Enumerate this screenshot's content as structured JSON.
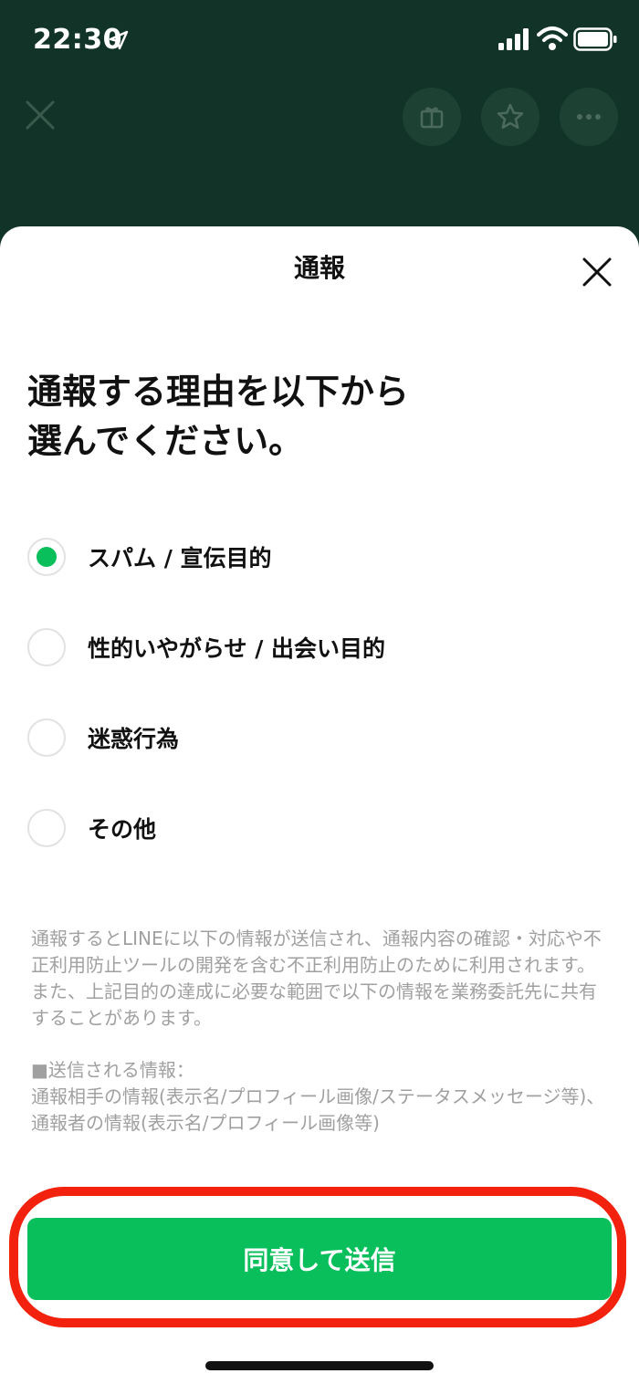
{
  "status_bar": {
    "time": "22:30",
    "icons": [
      "location-arrow-icon",
      "signal-icon",
      "wifi-icon",
      "battery-icon"
    ]
  },
  "background_header": {
    "icons": [
      "close-icon",
      "present-icon",
      "star-icon",
      "more-icon"
    ]
  },
  "sheet": {
    "title": "通報",
    "close_icon": "close-icon",
    "prompt_line1": "通報する理由を以下から",
    "prompt_line2": "選んでください。",
    "options": [
      {
        "label": "スパム / 宣伝目的",
        "selected": true
      },
      {
        "label": "性的いやがらせ / 出会い目的",
        "selected": false
      },
      {
        "label": "迷惑行為",
        "selected": false
      },
      {
        "label": "その他",
        "selected": false
      }
    ],
    "notice": {
      "para1": "通報するとLINEに以下の情報が送信され、通報内容の確認・対応や不正利用防止ツールの開発を含む不正利用防止のために利用されます。",
      "para2": "また、上記目的の達成に必要な範囲で以下の情報を業務委託先に共有することがあります。",
      "para3_heading": "■送信される情報：",
      "para3_body": "通報相手の情報(表示名/プロフィール画像/ステータスメッセージ等)、通報者の情報(表示名/プロフィール画像等)"
    },
    "submit_label": "同意して送信"
  },
  "colors": {
    "header_bg": "#123428",
    "accent_green": "#08bf5b",
    "highlight_red": "#f2220f",
    "notice_gray": "#a0a0a0"
  }
}
